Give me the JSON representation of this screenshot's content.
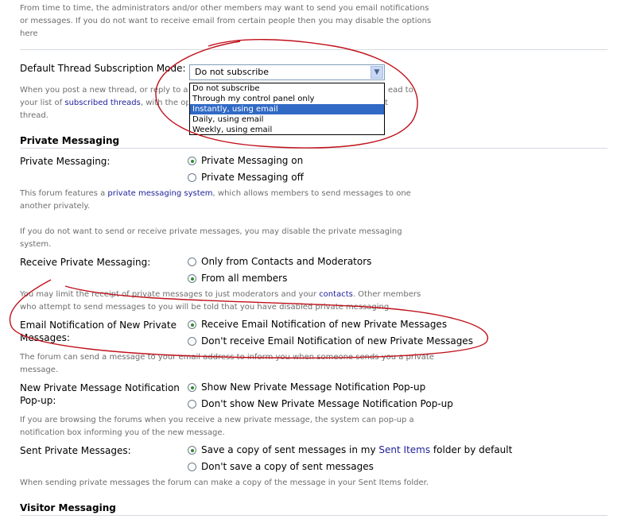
{
  "intro": {
    "line1": "From time to time, the administrators and/or other members may want to send you email notifications",
    "line2": "or messages. If you do not want to receive email from certain people then you may disable the options",
    "line3": "here"
  },
  "thread_subscription": {
    "label": "Default Thread Subscription Mode:",
    "selected_value": "Do not subscribe",
    "options": [
      "Do not subscribe",
      "Through my control panel only",
      "Instantly, using email",
      "Daily, using email",
      "Weekly, using email"
    ],
    "highlighted_option": "Instantly, using email",
    "desc_pre": "When you post a new thread, or reply to a t",
    "desc_tail1": "ead to",
    "desc_line2_pre": "your list of ",
    "desc_link": "subscribed threads",
    "desc_line2_post": ", with the opti",
    "desc_tail2": "t",
    "desc_line3": "thread."
  },
  "private_messaging": {
    "section_title": "Private Messaging",
    "pm_label": "Private Messaging:",
    "pm_on": "Private Messaging on",
    "pm_off": "Private Messaging off",
    "desc1_pre": "This forum features a ",
    "desc1_link": "private messaging system",
    "desc1_post": ", which allows members to send messages to one",
    "desc1_line2": "another privately.",
    "desc2_line1": "If you do not want to send or receive private messages, you may disable the private messaging",
    "desc2_line2": "system.",
    "receive_label": "Receive Private Messaging:",
    "receive_contacts": "Only from Contacts and Moderators",
    "receive_all": "From all members",
    "desc3_pre": "You may limit the receipt of private messages to just moderators and your ",
    "desc3_link": "contacts",
    "desc3_post": ". Other members",
    "desc3_line2": "who attempt to send messages to you will be told that you have disabled private messaging.",
    "email_label_1": "Email Notification of New Private",
    "email_label_2": "Messages:",
    "email_receive": "Receive Email Notification of new Private Messages",
    "email_dont": "Don't receive Email Notification of new Private Messages",
    "desc4_line1": "The forum can send a message to your email address to inform you when someone sends you a private",
    "desc4_line2": "message.",
    "popup_label_1": "New Private Message Notification",
    "popup_label_2": "Pop-up:",
    "popup_show": "Show New Private Message Notification Pop-up",
    "popup_dont": "Don't show New Private Message Notification Pop-up",
    "desc5_line1": "If you are browsing the forums when you receive a new private message, the system can pop-up a",
    "desc5_line2": "notification box informing you of the new message.",
    "sent_label": "Sent Private Messages:",
    "sent_save_pre": "Save a copy of sent messages in my ",
    "sent_save_link": "Sent Items",
    "sent_save_post": " folder by default",
    "sent_dont": "Don't save a copy of sent messages",
    "desc6": "When sending private messages the forum can make a copy of the message in your Sent Items folder."
  },
  "visitor_messaging": {
    "section_title": "Visitor Messaging"
  },
  "colors": {
    "link": "#22229c",
    "description_text": "#6d6d6d",
    "highlight": "#316ac5",
    "annotation": "#c0101a"
  }
}
